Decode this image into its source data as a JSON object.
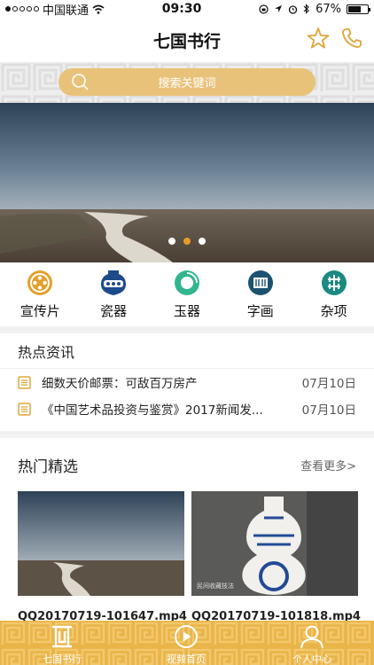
{
  "status_bar": {
    "carrier": "中国联通",
    "time": "09:30",
    "battery": "67%",
    "battery_level": 0.67
  },
  "nav": {
    "title": "七国书行"
  },
  "search": {
    "placeholder": "搜索关键词"
  },
  "banner": {
    "active_page": 2,
    "page_count": 3
  },
  "categories": [
    {
      "label": "宣传片",
      "icon": "film-reel-icon"
    },
    {
      "label": "瓷器",
      "icon": "vase-icon"
    },
    {
      "label": "玉器",
      "icon": "jade-disc-icon"
    },
    {
      "label": "字画",
      "icon": "calligraphy-icon"
    },
    {
      "label": "杂项",
      "icon": "misc-icon"
    }
  ],
  "news": {
    "title": "热点资讯",
    "items": [
      {
        "text": "细数天价邮票：可敌百万房产",
        "date": "07月10日"
      },
      {
        "text": "《中国艺术品投资与鉴赏》2017新闻发...",
        "date": "07月10日"
      }
    ]
  },
  "hot": {
    "title": "热门精选",
    "more": "查看更多>",
    "videos": [
      {
        "name": "QQ20170719-101647.mp4"
      },
      {
        "name": "QQ20170719-101818.mp4",
        "caption": "民间收藏技法"
      }
    ]
  },
  "tabbar": {
    "items": [
      {
        "label": "七国书行",
        "icon": "home-logo-icon"
      },
      {
        "label": "视频首页",
        "icon": "play-icon"
      },
      {
        "label": "个人中心",
        "icon": "user-icon"
      }
    ]
  },
  "colors": {
    "accent": "#e9b448",
    "search": "#e9c27a",
    "pager_active": "#e89b2a",
    "teal": "#1b8a80"
  }
}
